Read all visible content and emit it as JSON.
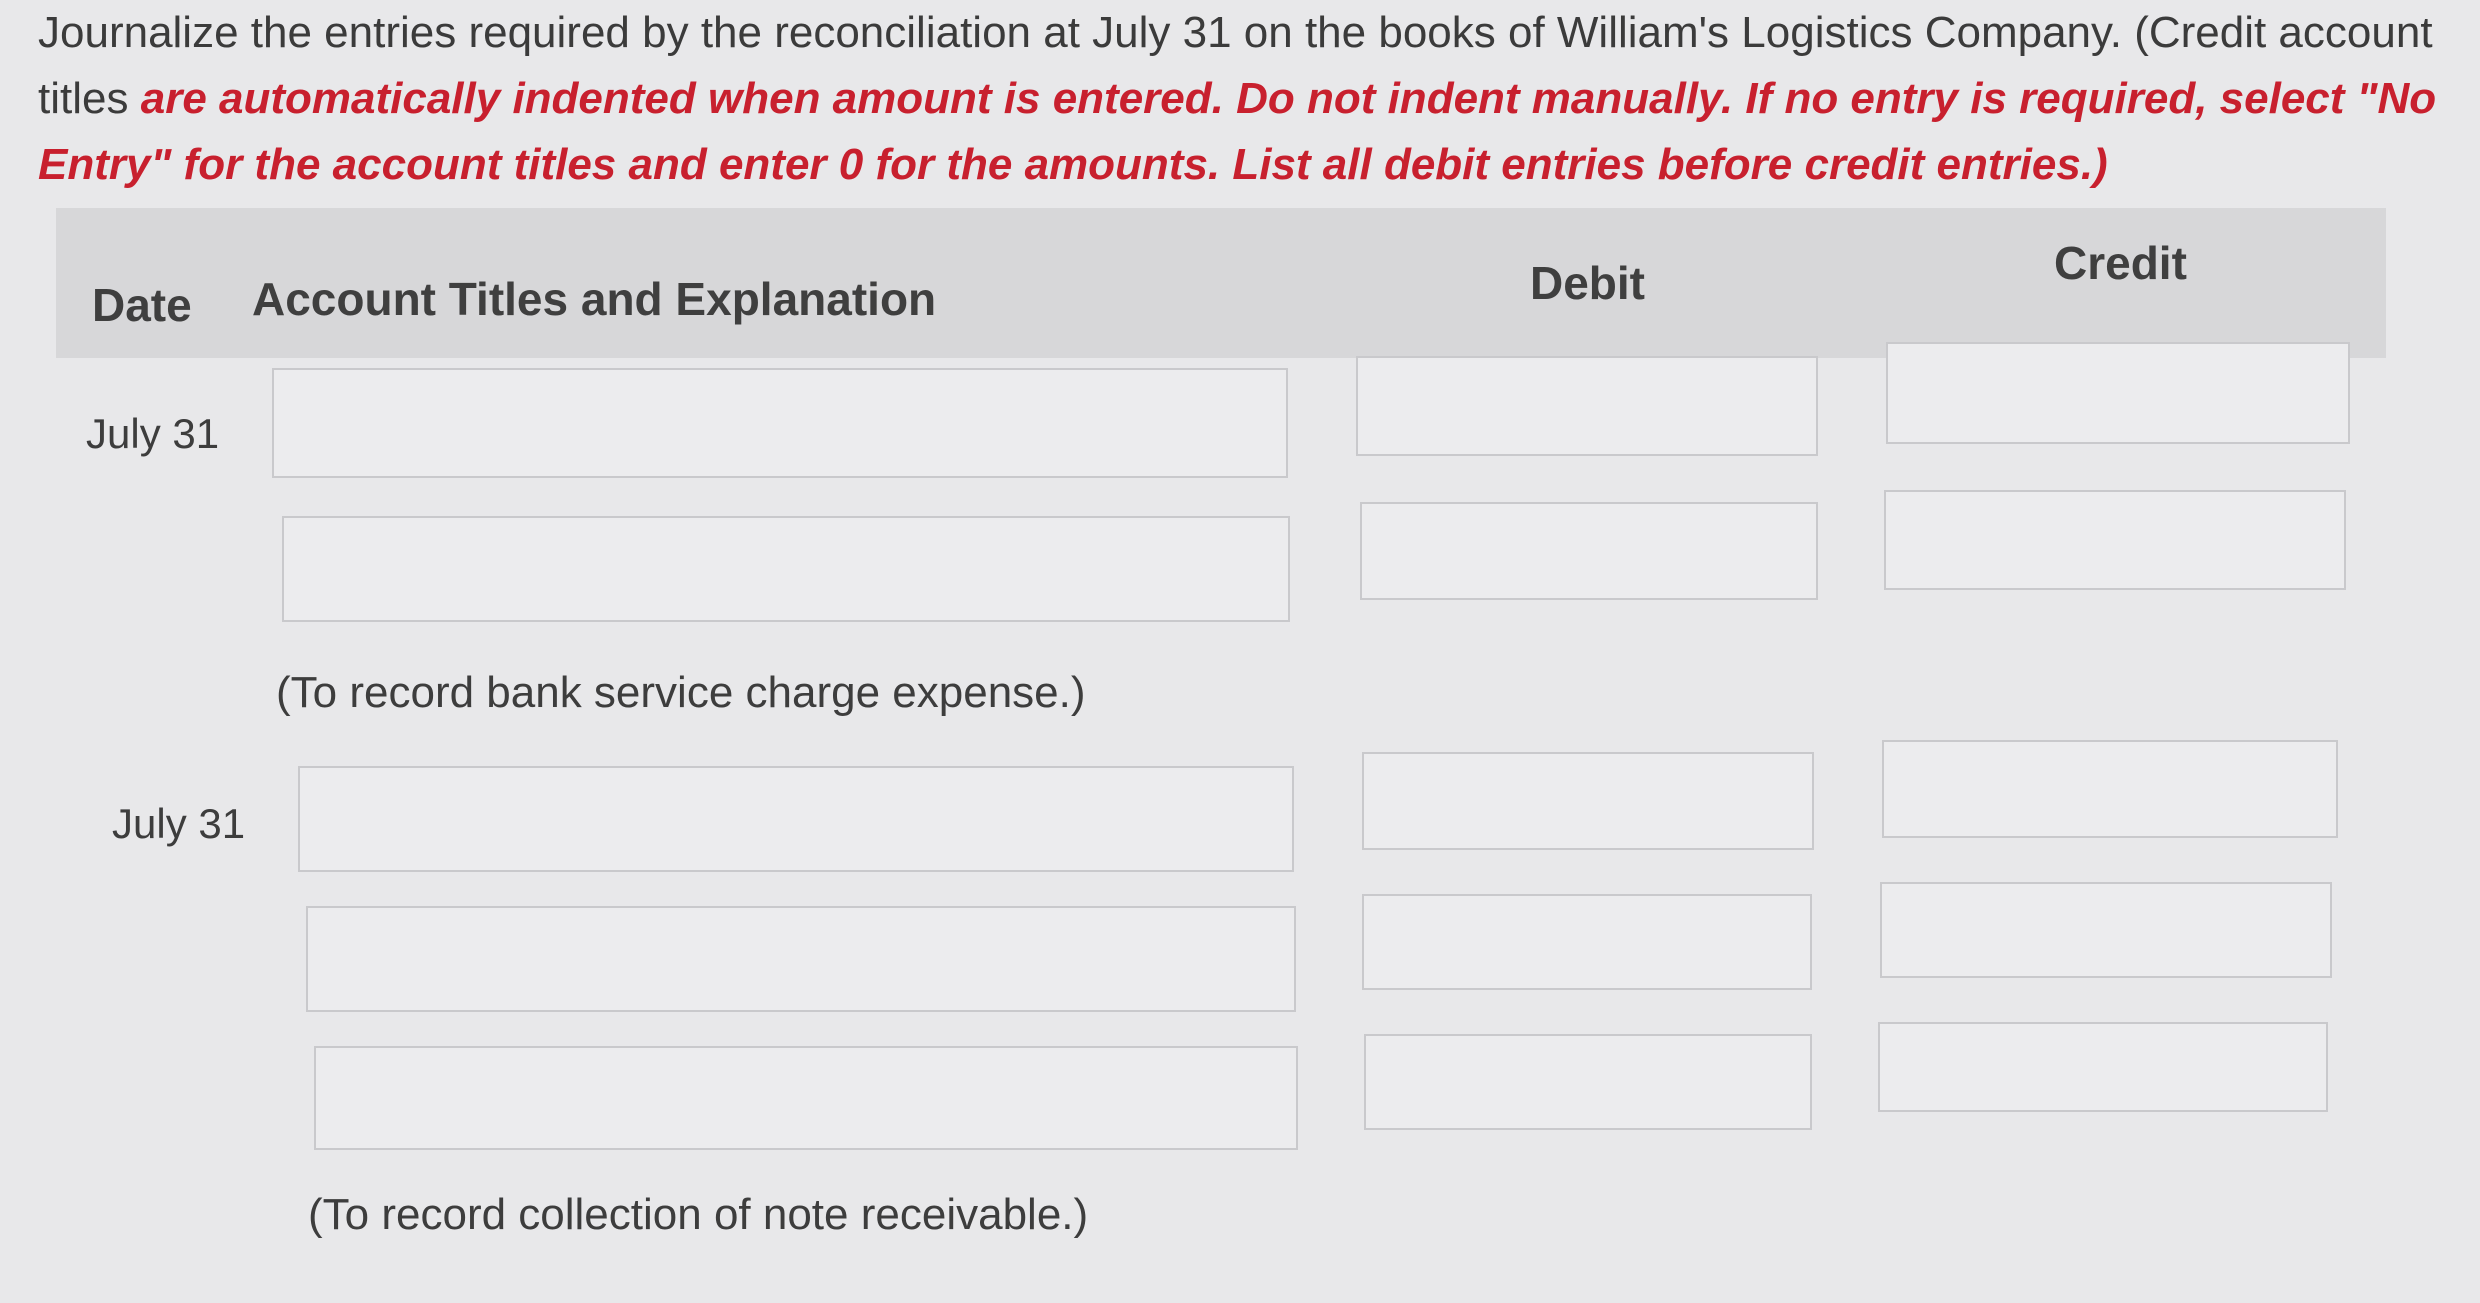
{
  "instructions": {
    "line1_plain": "Journalize the entries required by the reconciliation at July 31 on the books of William's Logistics Company. (Credit account titles",
    "line1_red": "are automatically indented when amount is entered. Do not indent manually. If no entry is required, select \"No Entry\" for the account titles and enter 0 for the amounts. List all debit entries before credit entries.)"
  },
  "table": {
    "headers": {
      "date": "Date",
      "account": "Account Titles and Explanation",
      "debit": "Debit",
      "credit": "Credit"
    }
  },
  "entries": [
    {
      "date": "July 31",
      "rows": [
        {
          "account": "",
          "debit": "",
          "credit": ""
        },
        {
          "account": "",
          "debit": "",
          "credit": ""
        }
      ],
      "explanation": "(To record bank service charge expense.)"
    },
    {
      "date": "July 31",
      "rows": [
        {
          "account": "",
          "debit": "",
          "credit": ""
        },
        {
          "account": "",
          "debit": "",
          "credit": ""
        },
        {
          "account": "",
          "debit": "",
          "credit": ""
        }
      ],
      "explanation": "(To record collection of note receivable.)"
    }
  ]
}
